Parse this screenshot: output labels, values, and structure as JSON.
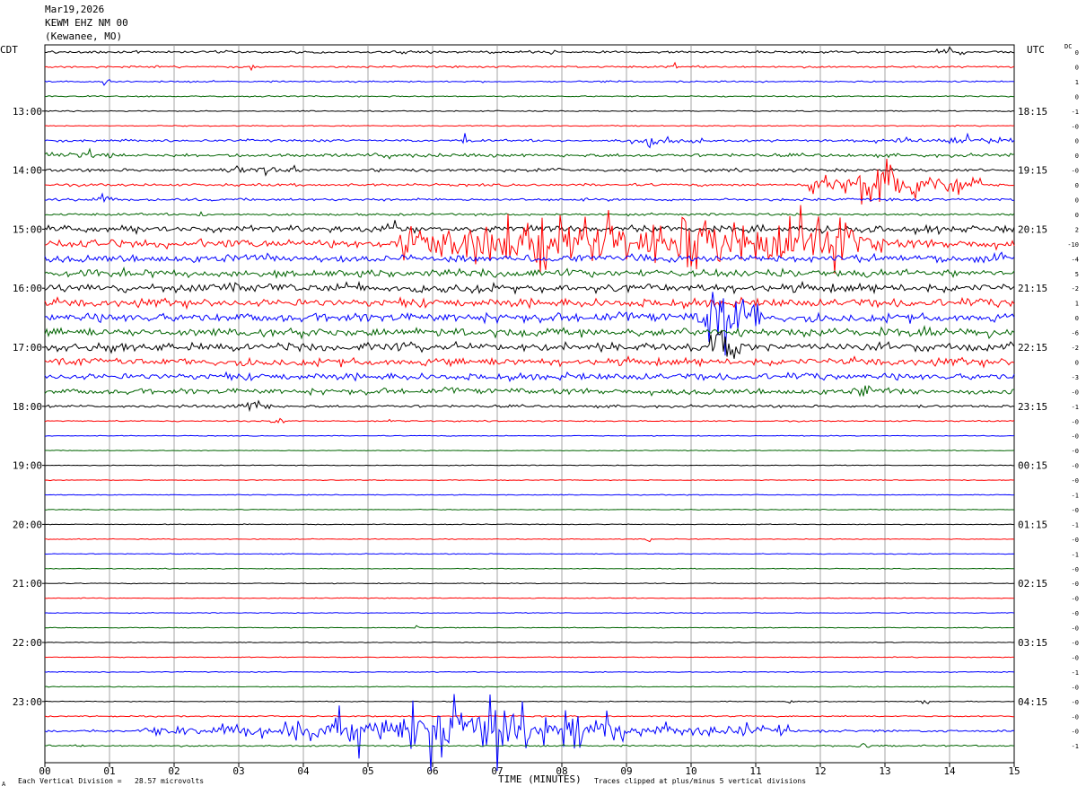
{
  "header": {
    "date": "Mar19,2026",
    "station": "KEWM EHZ NM 00",
    "location": "(Kewanee, MO)",
    "left_tz": "CDT",
    "right_tz": "UTC",
    "dc_label": "DC"
  },
  "footer": {
    "scale_note": "Each Vertical Division =   28.57 microvolts",
    "axis_title": "TIME (MINUTES)",
    "clip_note": "Traces clipped at plus/minus 5 vertical divisions",
    "corner_mark": "A"
  },
  "colors": {
    "trace_cycle": [
      "#000000",
      "#ff0000",
      "#0000ff",
      "#006400"
    ],
    "grid": "#909090",
    "frame": "#000000"
  },
  "chart_data": {
    "type": "line",
    "description_type": "helicorder",
    "x_ticks": [
      "00",
      "01",
      "02",
      "03",
      "04",
      "05",
      "06",
      "07",
      "08",
      "09",
      "10",
      "11",
      "12",
      "13",
      "14",
      "15"
    ],
    "xlim": [
      0,
      15
    ],
    "xlabel": "TIME (MINUTES)",
    "rows_per_hour": 4,
    "minutes_per_row": 15,
    "row_count": 48,
    "start_cdt": "12:00",
    "left_hour_labels": [
      "13:00",
      "14:00",
      "15:00",
      "16:00",
      "17:00",
      "18:00",
      "19:00",
      "20:00",
      "21:00",
      "22:00",
      "23:00"
    ],
    "right_hour_labels": [
      "18:15",
      "19:15",
      "20:15",
      "21:15",
      "22:15",
      "23:15",
      "00:15",
      "01:15",
      "02:15",
      "03:15",
      "04:15"
    ],
    "dc_offsets": [
      "0",
      "0",
      "1",
      "0",
      "-1",
      "-0",
      "0",
      "0",
      "-0",
      "0",
      "0",
      "0",
      "2",
      "-10",
      "-4",
      "5",
      "-2",
      "1",
      "0",
      "-6",
      "-2",
      "0",
      "-3",
      "-0",
      "-1",
      "-0",
      "-0",
      "-0",
      "-0",
      "-0",
      "-1",
      "-0",
      "-1",
      "-0",
      "-1",
      "-0",
      "-0",
      "-0",
      "-0",
      "-0",
      "-0",
      "-0",
      "-1",
      "-0",
      "-0",
      "-0",
      "-0",
      "-1"
    ],
    "noise_levels": [
      0.9,
      0.7,
      0.6,
      0.5,
      0.4,
      0.4,
      0.9,
      1.3,
      1.2,
      1.0,
      1.0,
      0.9,
      2.5,
      3.0,
      2.6,
      2.8,
      3.2,
      3.0,
      3.2,
      3.0,
      3.0,
      2.8,
      2.4,
      2.0,
      1.0,
      0.5,
      0.3,
      0.3,
      0.3,
      0.3,
      0.3,
      0.3,
      0.3,
      0.3,
      0.3,
      0.3,
      0.3,
      0.3,
      0.3,
      0.3,
      0.3,
      0.3,
      0.3,
      0.3,
      0.3,
      0.5,
      0.9,
      0.6
    ],
    "events": [
      {
        "row": 0,
        "start_min": 5.4,
        "end_min": 5.8,
        "amp": 4
      },
      {
        "row": 0,
        "start_min": 7.7,
        "end_min": 7.9,
        "amp": 4
      },
      {
        "row": 0,
        "start_min": 13.8,
        "end_min": 14.4,
        "amp": 5
      },
      {
        "row": 1,
        "start_min": 3.1,
        "end_min": 3.4,
        "amp": 3
      },
      {
        "row": 1,
        "start_min": 9.6,
        "end_min": 9.9,
        "amp": 3
      },
      {
        "row": 2,
        "start_min": 0.9,
        "end_min": 1.0,
        "amp": 9
      },
      {
        "row": 6,
        "start_min": 6.3,
        "end_min": 6.7,
        "amp": 6
      },
      {
        "row": 6,
        "start_min": 8.8,
        "end_min": 10.2,
        "amp": 5
      },
      {
        "row": 6,
        "start_min": 12.5,
        "end_min": 15.0,
        "amp": 5
      },
      {
        "row": 7,
        "start_min": 0.0,
        "end_min": 1.4,
        "amp": 5
      },
      {
        "row": 7,
        "start_min": 5.0,
        "end_min": 6.0,
        "amp": 4
      },
      {
        "row": 8,
        "start_min": 2.5,
        "end_min": 4.0,
        "amp": 6
      },
      {
        "row": 8,
        "start_min": 7.7,
        "end_min": 8.3,
        "amp": 5
      },
      {
        "row": 9,
        "start_min": 11.8,
        "end_min": 14.5,
        "amp": 18
      },
      {
        "row": 9,
        "start_min": 12.5,
        "end_min": 13.6,
        "amp": 40
      },
      {
        "row": 10,
        "start_min": 0.7,
        "end_min": 1.1,
        "amp": 6
      },
      {
        "row": 11,
        "start_min": 2.3,
        "end_min": 2.5,
        "amp": 8
      },
      {
        "row": 12,
        "start_min": 5.3,
        "end_min": 5.5,
        "amp": 9
      },
      {
        "row": 13,
        "start_min": 5.5,
        "end_min": 13.0,
        "amp": 40
      },
      {
        "row": 14,
        "start_min": 3.3,
        "end_min": 3.5,
        "amp": 8
      },
      {
        "row": 14,
        "start_min": 14.2,
        "end_min": 15.0,
        "amp": 8
      },
      {
        "row": 16,
        "start_min": 8.5,
        "end_min": 8.9,
        "amp": 6
      },
      {
        "row": 18,
        "start_min": 10.1,
        "end_min": 11.1,
        "amp": 40
      },
      {
        "row": 20,
        "start_min": 10.3,
        "end_min": 10.8,
        "amp": 40
      },
      {
        "row": 21,
        "start_min": 7.2,
        "end_min": 7.6,
        "amp": 8
      },
      {
        "row": 23,
        "start_min": 12.6,
        "end_min": 12.8,
        "amp": 8
      },
      {
        "row": 24,
        "start_min": 2.9,
        "end_min": 3.5,
        "amp": 9
      },
      {
        "row": 25,
        "start_min": 3.5,
        "end_min": 3.7,
        "amp": 7
      },
      {
        "row": 25,
        "start_min": 5.3,
        "end_min": 5.4,
        "amp": 5
      },
      {
        "row": 33,
        "start_min": 9.3,
        "end_min": 9.4,
        "amp": 6
      },
      {
        "row": 39,
        "start_min": 5.7,
        "end_min": 5.8,
        "amp": 5
      },
      {
        "row": 44,
        "start_min": 11.5,
        "end_min": 11.6,
        "amp": 4
      },
      {
        "row": 44,
        "start_min": 13.5,
        "end_min": 13.7,
        "amp": 5
      },
      {
        "row": 46,
        "start_min": 1.5,
        "end_min": 11.5,
        "amp": 12
      },
      {
        "row": 46,
        "start_min": 4.5,
        "end_min": 9.0,
        "amp": 40
      },
      {
        "row": 47,
        "start_min": 12.5,
        "end_min": 12.8,
        "amp": 6
      }
    ]
  }
}
